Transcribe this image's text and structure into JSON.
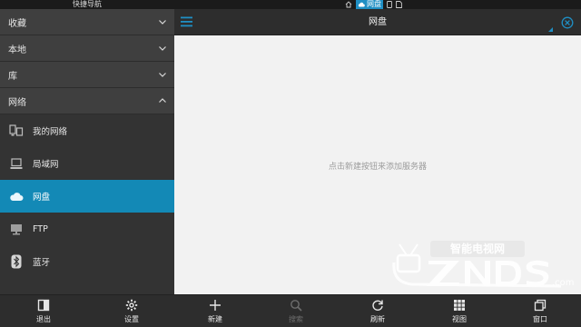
{
  "topbar": {
    "nav_title": "快捷导航",
    "window_tabs": [
      {
        "icon": "home-icon",
        "label": ""
      },
      {
        "icon": "cloud-icon",
        "label": "网盘",
        "active": true
      },
      {
        "icon": "phone-icon",
        "label": ""
      },
      {
        "icon": "document-icon",
        "label": ""
      }
    ]
  },
  "sidebar": {
    "sections": [
      {
        "label": "收藏",
        "expanded": false
      },
      {
        "label": "本地",
        "expanded": false
      },
      {
        "label": "库",
        "expanded": false
      },
      {
        "label": "网络",
        "expanded": true
      }
    ],
    "network_items": [
      {
        "label": "我的网络",
        "icon": "my-network-icon",
        "active": false
      },
      {
        "label": "局域网",
        "icon": "lan-icon",
        "active": false
      },
      {
        "label": "网盘",
        "icon": "cloud-drive-icon",
        "active": true
      },
      {
        "label": "FTP",
        "icon": "ftp-icon",
        "active": false
      },
      {
        "label": "蓝牙",
        "icon": "bluetooth-icon",
        "active": false
      }
    ]
  },
  "main": {
    "title": "网盘",
    "empty_hint": "点击新建按钮来添加服务器"
  },
  "bottom_bar": {
    "exit": "退出",
    "settings": "设置",
    "new": "新建",
    "search": "搜索",
    "refresh": "刷新",
    "view": "视图",
    "window": "窗口"
  },
  "watermark": {
    "brand": "ZNDS",
    "tagline": "智能电视网",
    "domain": ".com"
  },
  "colors": {
    "accent": "#1389b6",
    "sidebar_bg": "#3a3a3a",
    "content_bg": "#f2f2f2",
    "watermark": "#f3f3f3"
  }
}
